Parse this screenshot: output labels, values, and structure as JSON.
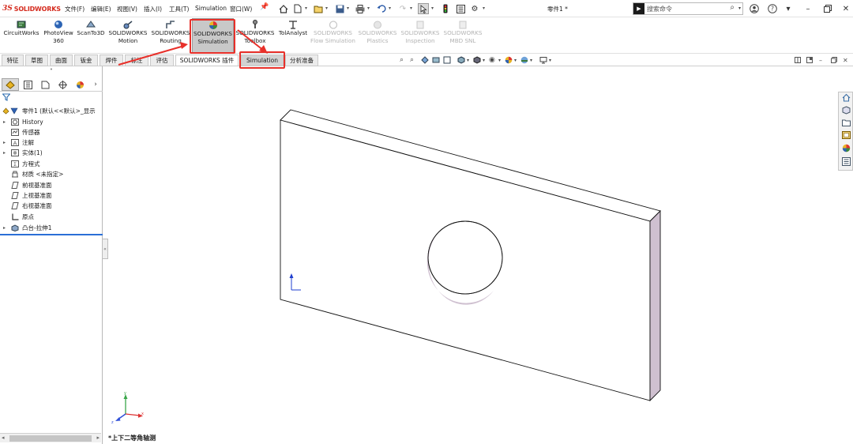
{
  "menubar": {
    "logo_ds": "3S",
    "logo_text": "SOLIDWORKS",
    "menus": [
      "文件(F)",
      "编辑(E)",
      "视图(V)",
      "插入(I)",
      "工具(T)",
      "Simulation",
      "窗口(W)"
    ],
    "pin_icon": "pin-icon",
    "document_title": "零件1 *",
    "search_prefix": "▶",
    "search_placeholder": "搜索命令"
  },
  "ribbon": {
    "buttons": [
      {
        "label": "CircuitWorks",
        "icon": "circuitworks-icon",
        "enabled": true
      },
      {
        "label": "PhotoView 360",
        "icon": "photoview-icon",
        "enabled": true
      },
      {
        "label": "ScanTo3D",
        "icon": "scanto3d-icon",
        "enabled": true
      },
      {
        "label": "SOLIDWORKS Motion",
        "icon": "motion-icon",
        "enabled": true
      },
      {
        "label": "SOLIDWORKS Routing",
        "icon": "routing-icon",
        "enabled": true
      },
      {
        "label": "SOLIDWORKS Simulation",
        "icon": "simulation-icon",
        "enabled": true,
        "selected": true
      },
      {
        "label": "SOLIDWORKS Toolbox",
        "icon": "toolbox-icon",
        "enabled": true
      },
      {
        "label": "TolAnalyst",
        "icon": "tolanalyst-icon",
        "enabled": true
      },
      {
        "label": "SOLIDWORKS Flow Simulation",
        "icon": "flow-simulation-icon",
        "enabled": false
      },
      {
        "label": "SOLIDWORKS Plastics",
        "icon": "plastics-icon",
        "enabled": false
      },
      {
        "label": "SOLIDWORKS Inspection",
        "icon": "inspection-icon",
        "enabled": false
      },
      {
        "label": "SOLIDWORKS MBD SNL",
        "icon": "mbd-snl-icon",
        "enabled": false
      }
    ]
  },
  "tabs": [
    "特征",
    "草图",
    "曲面",
    "钣金",
    "焊件",
    "标注",
    "评估",
    "SOLIDWORKS 插件",
    "Simulation",
    "分析准备"
  ],
  "tree": {
    "root": "零件1 (默认<<默认>_显示",
    "items": [
      {
        "label": "History",
        "icon": "history-icon",
        "expandable": true
      },
      {
        "label": "传感器",
        "icon": "sensor-icon",
        "expandable": false
      },
      {
        "label": "注解",
        "icon": "annotations-icon",
        "expandable": true
      },
      {
        "label": "实体(1)",
        "icon": "solid-bodies-icon",
        "expandable": true
      },
      {
        "label": "方程式",
        "icon": "equations-icon",
        "expandable": false
      },
      {
        "label": "材质 <未指定>",
        "icon": "material-icon",
        "expandable": false
      },
      {
        "label": "前视基准面",
        "icon": "plane-icon",
        "expandable": false
      },
      {
        "label": "上视基准面",
        "icon": "plane-icon",
        "expandable": false
      },
      {
        "label": "右视基准面",
        "icon": "plane-icon",
        "expandable": false
      },
      {
        "label": "原点",
        "icon": "origin-icon",
        "expandable": false
      },
      {
        "label": "凸台-拉伸1",
        "icon": "boss-extrude-icon",
        "expandable": true
      }
    ]
  },
  "viewport": {
    "view_name": "*上下二等角轴测",
    "triad_x": "x",
    "triad_y": "y",
    "triad_z": "z"
  },
  "colors": {
    "accent_red": "#e8302a",
    "brand_red": "#d52b1e",
    "rollback_blue": "#2b6fd6"
  }
}
